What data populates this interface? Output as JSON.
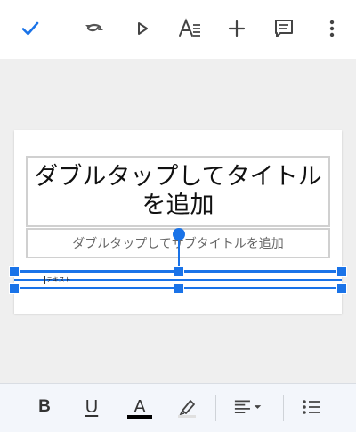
{
  "toolbar": {
    "done_icon": "checkmark-icon",
    "undo_icon": "undo-icon",
    "present_icon": "play-icon",
    "format_icon": "text-format-icon",
    "insert_icon": "plus-icon",
    "comment_icon": "comment-icon",
    "more_icon": "more-vert-icon"
  },
  "slide": {
    "title_placeholder": "ダブルタップしてタイトルを追加",
    "subtitle_placeholder": "ダブルタップしてサブタイトルを追加",
    "table_cell_text": "テキスト"
  },
  "format_bar": {
    "bold_label": "B",
    "underline_label": "U",
    "text_color_label": "A",
    "highlight_icon": "highlighter-icon",
    "align_icon": "align-left-dropdown-icon",
    "list_icon": "bulleted-list-icon",
    "text_color": "#000000"
  },
  "colors": {
    "accent": "#1a73e8",
    "toolbar_bg": "#ffffff",
    "canvas_bg": "#efefef",
    "bottom_bar_bg": "#f3f6fb"
  }
}
